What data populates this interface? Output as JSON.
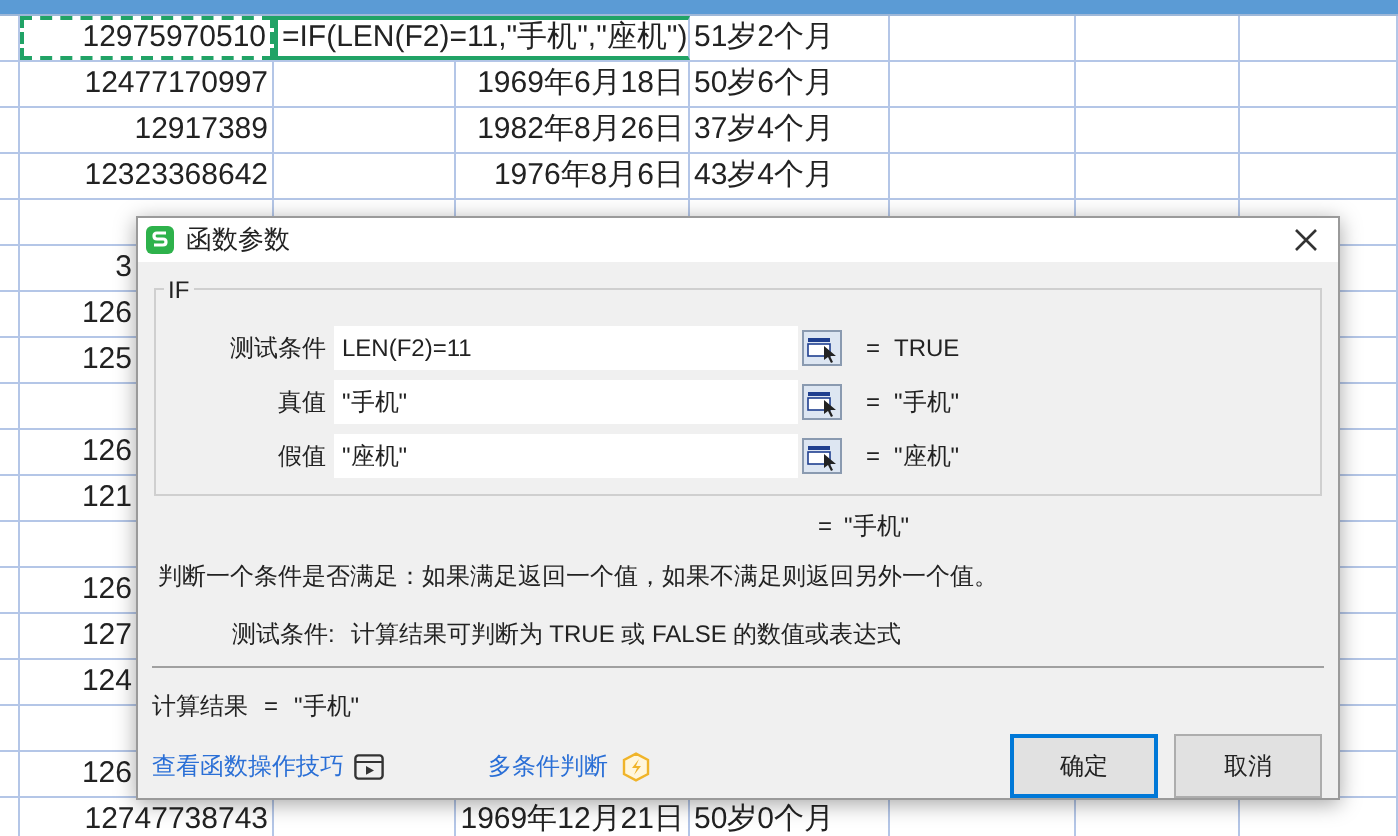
{
  "sheet": {
    "rows": [
      {
        "cells": [
          "12975970510",
          "=IF(LEN(F2)=11,\"手机\",\"座机\")",
          "",
          "51岁2个月"
        ],
        "marquee": true,
        "editing": true
      },
      {
        "cells": [
          "12477170997",
          "",
          "1969年6月18日",
          "50岁6个月"
        ],
        "marquee": false,
        "editing": false
      },
      {
        "cells": [
          "12917389",
          "",
          "1982年8月26日",
          "37岁4个月"
        ],
        "marquee": false,
        "editing": false
      },
      {
        "cells": [
          "12323368642",
          "",
          "1976年8月6日",
          "43岁4个月"
        ],
        "marquee": false,
        "editing": false
      },
      {
        "cells": [
          "",
          "",
          "",
          ""
        ],
        "marquee": false,
        "editing": false
      },
      {
        "cells": [
          "3",
          "",
          "",
          ""
        ],
        "marquee": false,
        "editing": false
      },
      {
        "cells": [
          "126",
          "",
          "",
          ""
        ],
        "marquee": false,
        "editing": false
      },
      {
        "cells": [
          "125",
          "",
          "",
          ""
        ],
        "marquee": false,
        "editing": false
      },
      {
        "cells": [
          "",
          "",
          "",
          ""
        ],
        "marquee": false,
        "editing": false
      },
      {
        "cells": [
          "126",
          "",
          "",
          ""
        ],
        "marquee": false,
        "editing": false
      },
      {
        "cells": [
          "121",
          "",
          "",
          ""
        ],
        "marquee": false,
        "editing": false
      },
      {
        "cells": [
          "",
          "",
          "",
          ""
        ],
        "marquee": false,
        "editing": false
      },
      {
        "cells": [
          "126",
          "",
          "",
          ""
        ],
        "marquee": false,
        "editing": false
      },
      {
        "cells": [
          "127",
          "",
          "",
          ""
        ],
        "marquee": false,
        "editing": false
      },
      {
        "cells": [
          "124",
          "",
          "",
          ""
        ],
        "marquee": false,
        "editing": false
      },
      {
        "cells": [
          "",
          "",
          "",
          ""
        ],
        "marquee": false,
        "editing": false
      },
      {
        "cells": [
          "126",
          "",
          "",
          ""
        ],
        "marquee": false,
        "editing": false
      },
      {
        "cells": [
          "12747738743",
          "",
          "1969年12月21日",
          "50岁0个月"
        ],
        "marquee": false,
        "editing": false
      }
    ]
  },
  "dialog": {
    "title": "函数参数",
    "group": "IF",
    "args": [
      {
        "label": "测试条件",
        "value": "LEN(F2)=11",
        "result": "TRUE"
      },
      {
        "label": "真值",
        "value": "\"手机\"",
        "result": "\"手机\""
      },
      {
        "label": "假值",
        "value": "\"座机\"",
        "result": "\"座机\""
      }
    ],
    "eq": "=",
    "overall": "\"手机\"",
    "description": "判断一个条件是否满足：如果满足返回一个值，如果不满足则返回另外一个值。",
    "arg_help_label": "测试条件:",
    "arg_help": "计算结果可判断为 TRUE 或 FALSE 的数值或表达式",
    "result_label": "计算结果",
    "result_value": "\"手机\"",
    "tips_link": "查看函数操作技巧",
    "multi_link": "多条件判断",
    "buttons": [
      {
        "label": "确定",
        "default": true
      },
      {
        "label": "取消",
        "default": false
      }
    ]
  }
}
